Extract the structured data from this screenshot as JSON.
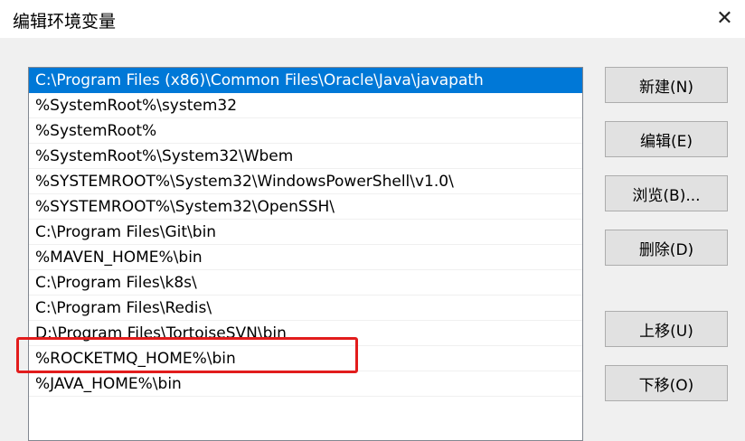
{
  "window": {
    "title": "编辑环境变量",
    "close_glyph": "✕"
  },
  "list": {
    "items": [
      "C:\\Program Files (x86)\\Common Files\\Oracle\\Java\\javapath",
      "%SystemRoot%\\system32",
      "%SystemRoot%",
      "%SystemRoot%\\System32\\Wbem",
      "%SYSTEMROOT%\\System32\\WindowsPowerShell\\v1.0\\",
      "%SYSTEMROOT%\\System32\\OpenSSH\\",
      "C:\\Program Files\\Git\\bin",
      "%MAVEN_HOME%\\bin",
      "C:\\Program Files\\k8s\\",
      "C:\\Program Files\\Redis\\",
      "D:\\Program Files\\TortoiseSVN\\bin",
      "%ROCKETMQ_HOME%\\bin",
      "%JAVA_HOME%\\bin"
    ],
    "selected_index": 0,
    "highlighted_index": 11
  },
  "buttons": {
    "new": "新建(N)",
    "edit": "编辑(E)",
    "browse": "浏览(B)...",
    "delete": "删除(D)",
    "move_up": "上移(U)",
    "move_down": "下移(O)"
  },
  "colors": {
    "selection": "#0078d7",
    "annotation": "#e21c1c"
  }
}
